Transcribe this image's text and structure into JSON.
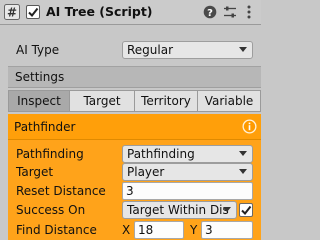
{
  "header": {
    "title": "AI Tree (Script)",
    "enabled": true,
    "icons": [
      "script-hash-icon",
      "help-icon",
      "preset-sliders-icon",
      "more-icon"
    ]
  },
  "ai_type": {
    "label": "AI Type",
    "value": "Regular"
  },
  "settings": {
    "label": "Settings"
  },
  "tabs": [
    {
      "label": "Inspect",
      "active": true
    },
    {
      "label": "Target",
      "active": false
    },
    {
      "label": "Territory",
      "active": false
    },
    {
      "label": "Variable",
      "active": false
    }
  ],
  "panel": {
    "title": "Pathfinder",
    "accent": "#ffa31a",
    "fields": {
      "pathfinding": {
        "label": "Pathfinding",
        "value": "Pathfinding"
      },
      "target": {
        "label": "Target",
        "value": "Player"
      },
      "reset_distance": {
        "label": "Reset Distance",
        "value": "3"
      },
      "success_on": {
        "label": "Success On",
        "value": "Target Within Dis",
        "checked": true
      },
      "find_distance": {
        "label": "Find Distance",
        "x_label": "X",
        "x_value": "18",
        "y_label": "Y",
        "y_value": "3"
      }
    }
  }
}
